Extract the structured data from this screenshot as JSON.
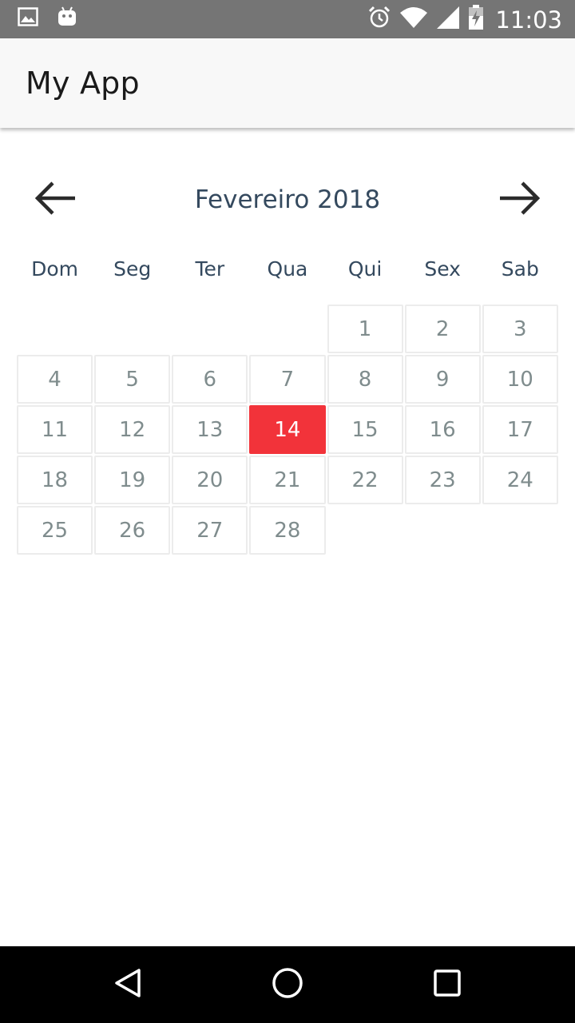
{
  "status_bar": {
    "time": "11:03",
    "icons": [
      "image-icon",
      "android-icon",
      "alarm-icon",
      "wifi-icon",
      "signal-icon",
      "battery-charging-icon"
    ]
  },
  "app_bar": {
    "title": "My App"
  },
  "calendar": {
    "month_label": "Fevereiro 2018",
    "prev_icon": "arrow-left-icon",
    "next_icon": "arrow-right-icon",
    "weekdays": [
      "Dom",
      "Seg",
      "Ter",
      "Qua",
      "Qui",
      "Sex",
      "Sab"
    ],
    "leading_empty_days": 4,
    "days": [
      "1",
      "2",
      "3",
      "4",
      "5",
      "6",
      "7",
      "8",
      "9",
      "10",
      "11",
      "12",
      "13",
      "14",
      "15",
      "16",
      "17",
      "18",
      "19",
      "20",
      "21",
      "22",
      "23",
      "24",
      "25",
      "26",
      "27",
      "28"
    ],
    "selected_day": "14"
  },
  "nav_bar": {
    "icons": [
      "back-triangle-icon",
      "home-circle-icon",
      "recents-square-icon"
    ]
  },
  "colors": {
    "status_bar": "#757575",
    "app_bar": "#f8f8f8",
    "selected": "#f2333a",
    "header_text": "#34495e",
    "day_text": "#7f8c8d"
  }
}
